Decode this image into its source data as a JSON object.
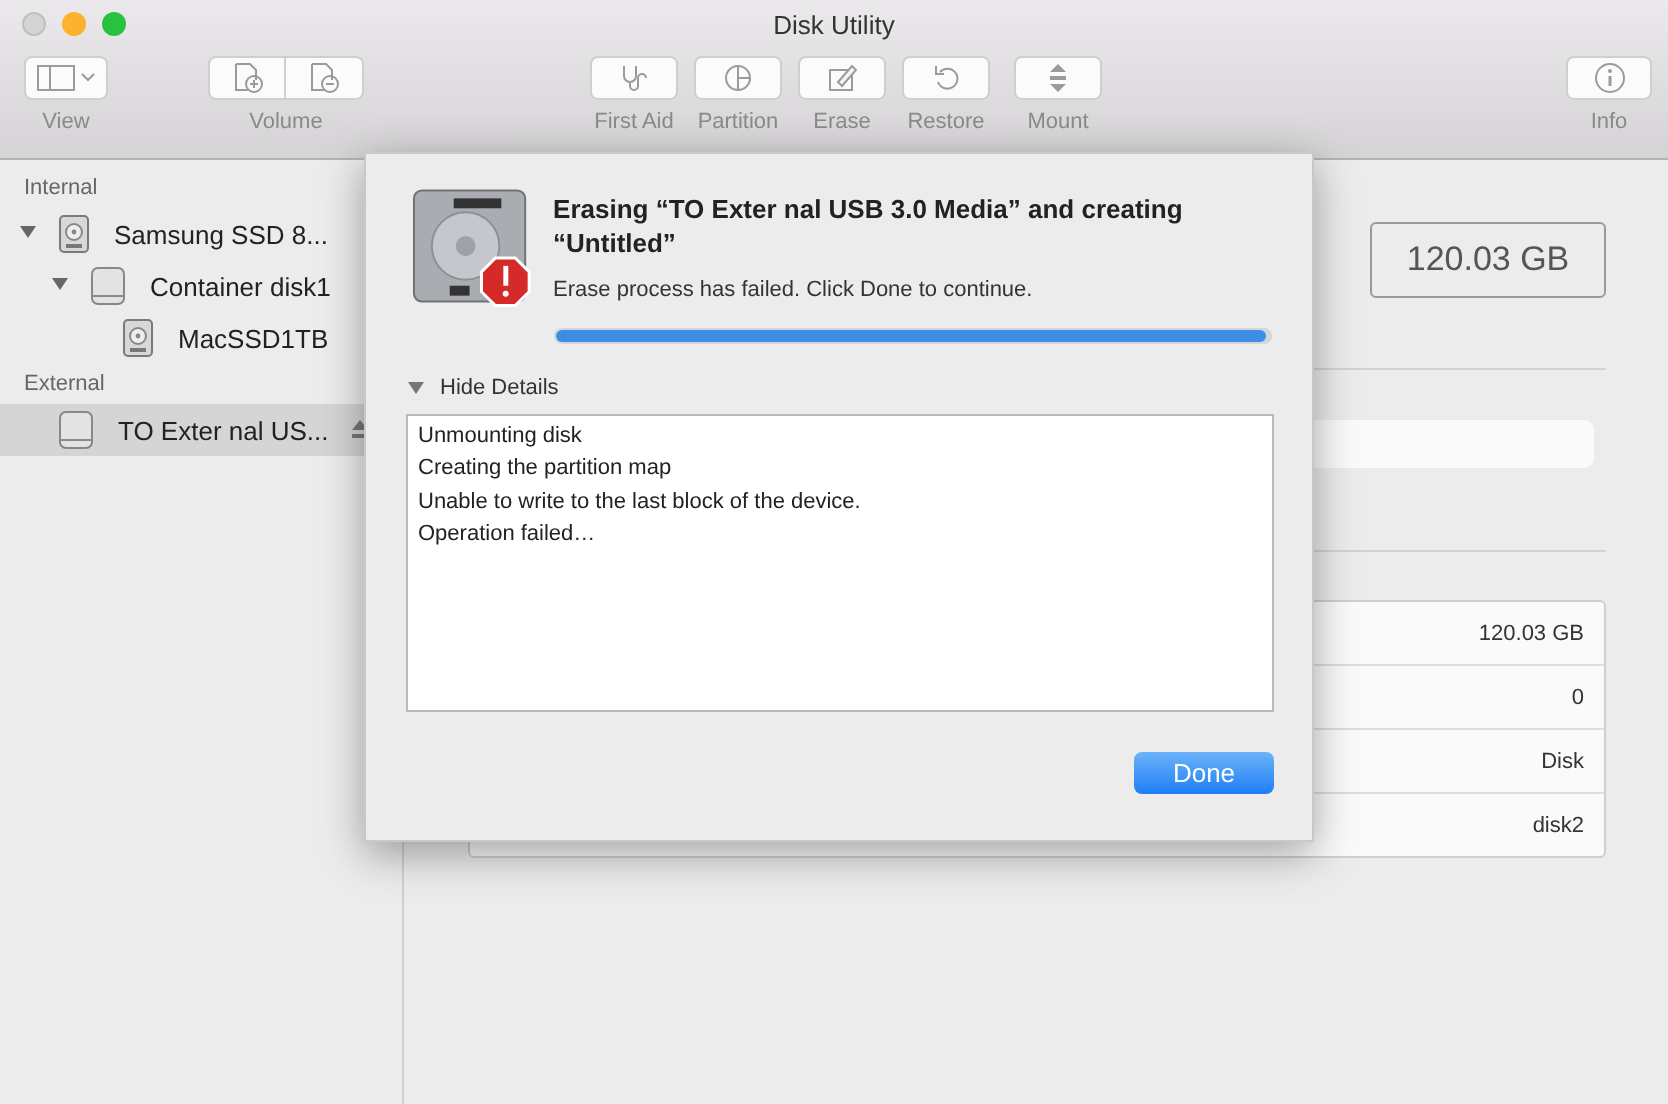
{
  "window": {
    "title": "Disk Utility"
  },
  "toolbar": [
    {
      "kind": "view",
      "label": "View"
    },
    {
      "kind": "volume",
      "label": "Volume"
    },
    {
      "kind": "first_aid",
      "label": "First Aid"
    },
    {
      "kind": "partition",
      "label": "Partition"
    },
    {
      "kind": "erase",
      "label": "Erase"
    },
    {
      "kind": "restore",
      "label": "Restore"
    },
    {
      "kind": "mount",
      "label": "Mount"
    },
    {
      "kind": "info",
      "label": "Info"
    }
  ],
  "sidebar": {
    "sections": [
      {
        "heading": "Internal",
        "items": [
          {
            "label": "Samsung SSD 8...",
            "kind": "drive",
            "selected": false,
            "expanded": true,
            "children": [
              {
                "label": "Container disk1",
                "kind": "container",
                "selected": false,
                "expanded": true,
                "children": [
                  {
                    "label": "MacSSD1TB",
                    "kind": "drive",
                    "selected": false
                  }
                ]
              }
            ]
          }
        ]
      },
      {
        "heading": "External",
        "items": [
          {
            "label": "TO Exter nal US...",
            "kind": "external",
            "selected": true,
            "ejectable": true
          }
        ]
      }
    ]
  },
  "main": {
    "capacity": "120.03 GB",
    "info_table": {
      "rows": [
        {
          "column_2": "120.03 GB"
        },
        {
          "column_2": "0"
        },
        {
          "column_2": "Disk"
        },
        {
          "column_2": "disk2"
        }
      ]
    }
  },
  "sheet": {
    "title": "Erasing “TO Exter nal USB 3.0 Media” and creating “Untitled”",
    "message": "Erase process has failed. Click Done to continue.",
    "progress": {
      "level": 1.0
    },
    "details": {
      "label": "Hide Details",
      "expanded": true,
      "log": [
        "Unmounting disk",
        "Creating the partition map",
        "Unable to write to the last block of the device.",
        "Operation failed…"
      ]
    },
    "buttons": [
      "Done"
    ]
  }
}
